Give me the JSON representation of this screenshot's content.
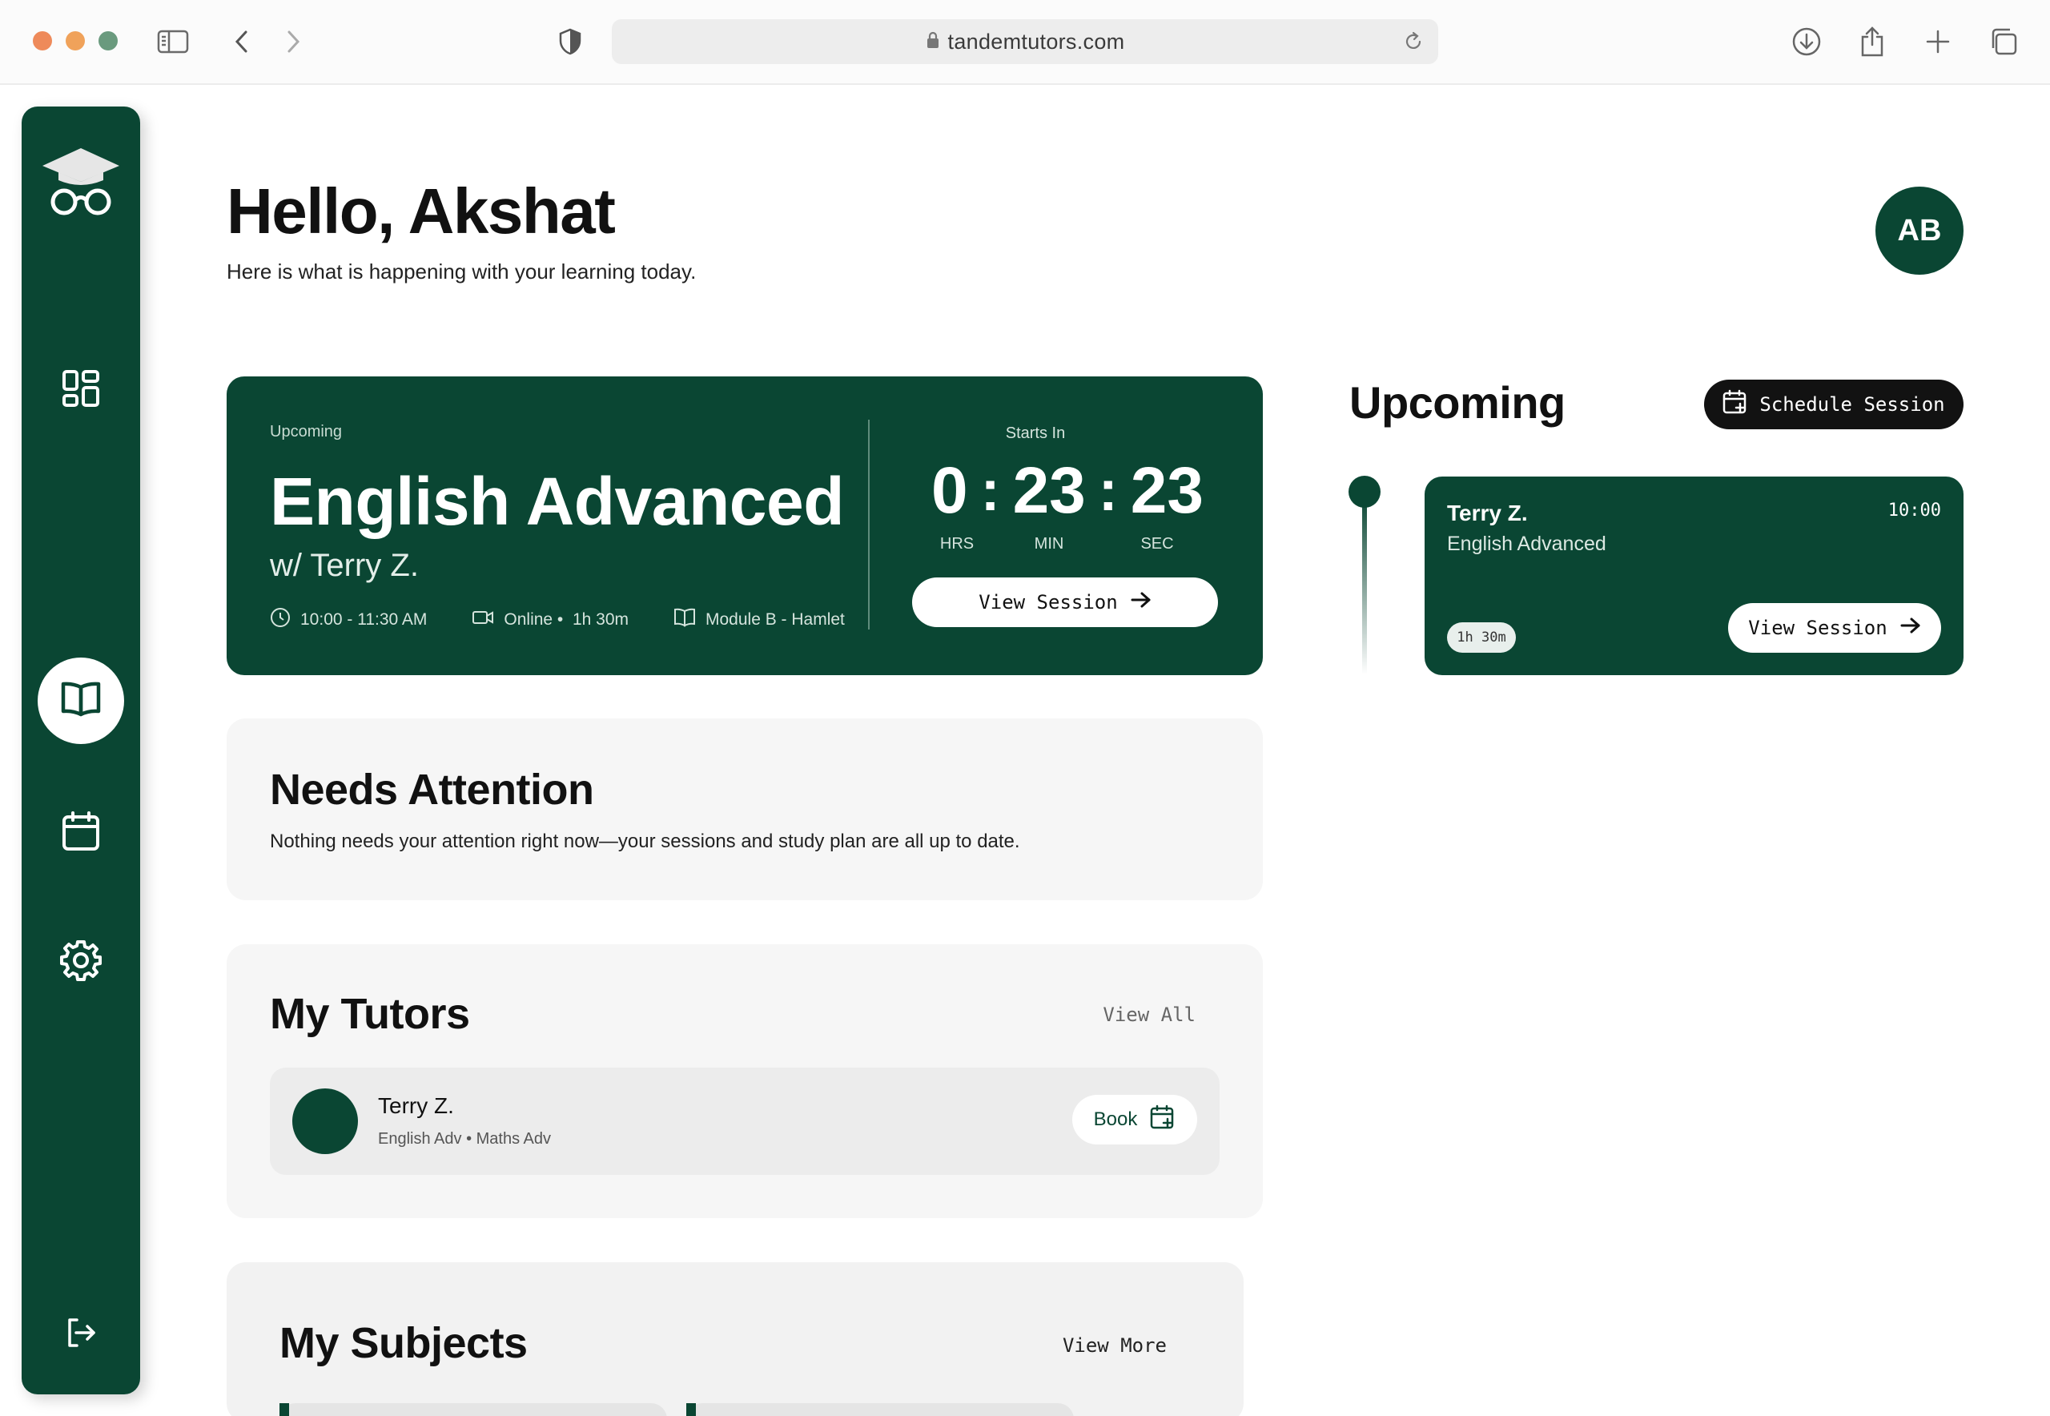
{
  "browser": {
    "url": "tandemtutors.com"
  },
  "header": {
    "greeting": "Hello, Akshat",
    "subtitle": "Here is what is happening with your learning today.",
    "avatar_initials": "AB"
  },
  "sidebar": {
    "items": [
      {
        "icon": "dashboard-icon"
      },
      {
        "icon": "book-icon",
        "active": true
      },
      {
        "icon": "calendar-icon"
      },
      {
        "icon": "gear-icon"
      },
      {
        "icon": "logout-icon"
      }
    ]
  },
  "hero": {
    "tag": "Upcoming",
    "title": "English Advanced",
    "tutor": "w/ Terry Z.",
    "time": "10:00 - 11:30 AM",
    "mode": "Online •",
    "duration": "1h 30m",
    "module": "Module B - Hamlet",
    "starts_in_label": "Starts In",
    "countdown": {
      "hrs": "0",
      "min": "23",
      "sec": "23"
    },
    "countdown_labels": {
      "hrs": "HRS",
      "min": "MIN",
      "sec": "SEC"
    },
    "view_button": "View Session"
  },
  "needs_attention": {
    "title": "Needs Attention",
    "message": "Nothing needs your attention right now—your sessions and study plan are all up to date."
  },
  "tutors": {
    "title": "My Tutors",
    "view_all": "View All",
    "items": [
      {
        "name": "Terry Z.",
        "subjects": "English Adv • Maths Adv",
        "book_label": "Book"
      }
    ]
  },
  "subjects": {
    "title": "My Subjects",
    "view_more": "View More"
  },
  "upcoming": {
    "title": "Upcoming",
    "schedule_button": "Schedule Session",
    "sessions": [
      {
        "tutor": "Terry Z.",
        "subject": "English Advanced",
        "time": "10:00",
        "duration": "1h 30m",
        "button": "View Session"
      }
    ]
  },
  "colors": {
    "brand_green": "#0a4633",
    "panel_bg": "#f6f6f6",
    "dark_button": "#121212"
  }
}
